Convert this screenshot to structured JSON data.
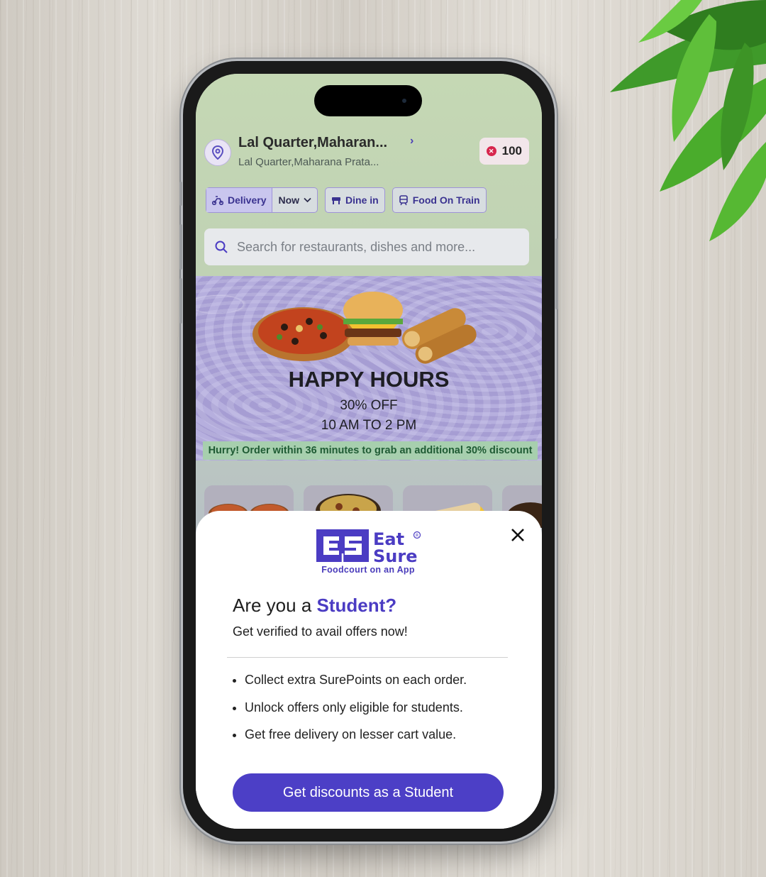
{
  "location": {
    "title": "Lal Quarter,Maharan...",
    "subtitle": "Lal Quarter,Maharana Prata..."
  },
  "points": {
    "value": "100"
  },
  "modes": {
    "delivery_label": "Delivery",
    "time_label": "Now",
    "dinein_label": "Dine in",
    "train_label": "Food On Train"
  },
  "search": {
    "placeholder": "Search for restaurants, dishes and more..."
  },
  "banner": {
    "title": "HAPPY HOURS",
    "line1": "30% OFF",
    "line2": "10 AM TO 2 PM",
    "hurry": "Hurry! Order within 36 minutes to grab an additional 30% discount"
  },
  "modal": {
    "brand_top": "Eat",
    "brand_bottom": "Sure",
    "brand_mark": "ES",
    "tagline": "Foodcourt on an App",
    "question_prefix": "Are you a",
    "question_highlight": "Student?",
    "subtitle": "Get verified to avail offers now!",
    "benefits": [
      "Collect extra SurePoints on each order.",
      "Unlock offers only eligible for students.",
      "Get free delivery on lesser cart value."
    ],
    "cta_label": "Get discounts as a Student"
  },
  "colors": {
    "brand": "#4c3fc6",
    "hurry_bg": "#a7cfae",
    "hurry_text": "#1f5b34",
    "points_dot": "#d7264d"
  }
}
